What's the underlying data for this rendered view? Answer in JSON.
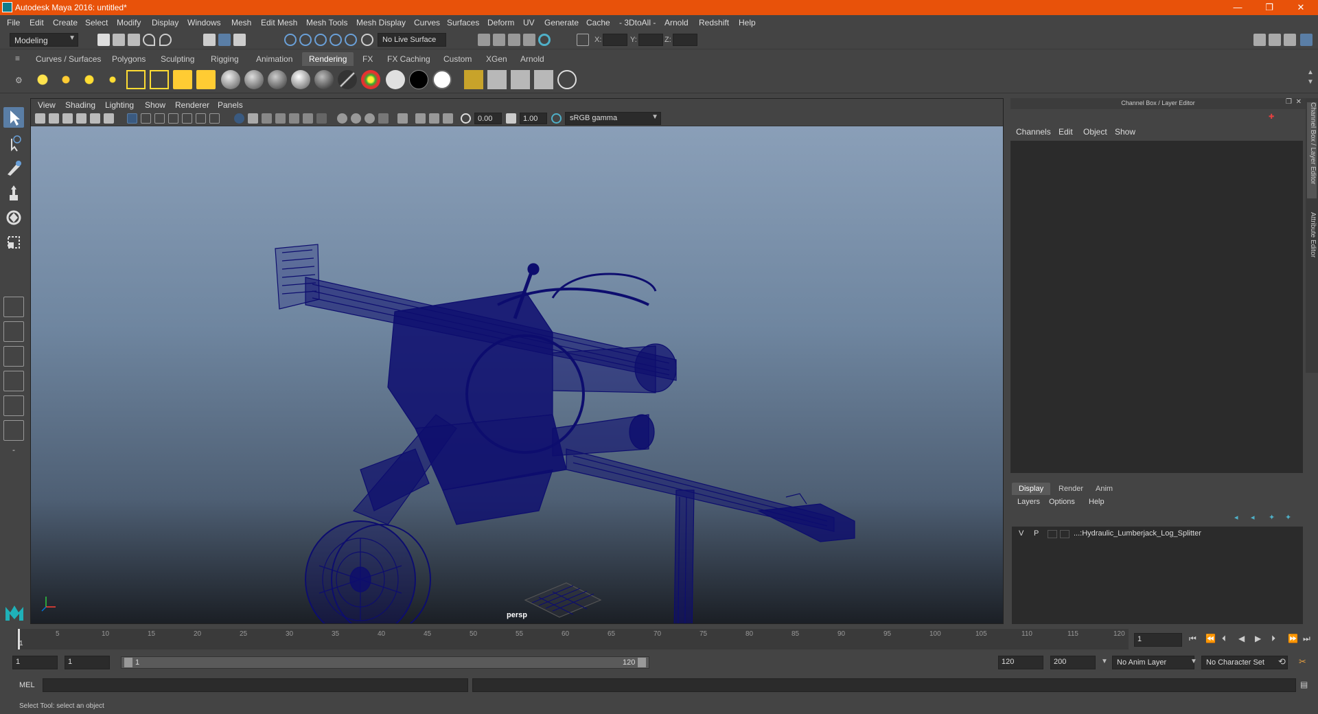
{
  "titlebar": {
    "title": "Autodesk Maya 2016: untitled*",
    "minimize": "—",
    "maximize": "❐",
    "close": "✕"
  },
  "menus": [
    "File",
    "Edit",
    "Create",
    "Select",
    "Modify",
    "Display",
    "Windows",
    "Mesh",
    "Edit Mesh",
    "Mesh Tools",
    "Mesh Display",
    "Curves",
    "Surfaces",
    "Deform",
    "UV",
    "Generate",
    "Cache",
    "- 3DtoAll -",
    "Arnold",
    "Redshift",
    "Help"
  ],
  "statusline": {
    "menu_set": "Modeling",
    "live_surface": "No Live Surface",
    "x_label": "X:",
    "y_label": "Y:",
    "z_label": "Z:"
  },
  "shelf": {
    "tabs": [
      "Curves / Surfaces",
      "Polygons",
      "Sculpting",
      "Rigging",
      "Animation",
      "Rendering",
      "FX",
      "FX Caching",
      "Custom",
      "XGen",
      "Arnold"
    ],
    "active_tab": "Rendering"
  },
  "viewport": {
    "menus": [
      "View",
      "Shading",
      "Lighting",
      "Show",
      "Renderer",
      "Panels"
    ],
    "exposure": "0.00",
    "gamma": "1.00",
    "color_space": "sRGB gamma",
    "camera": "persp",
    "wire_color": "#0d0d6e"
  },
  "rightpanel": {
    "title": "Channel Box / Layer Editor",
    "menus": [
      "Channels",
      "Edit",
      "Object",
      "Show"
    ],
    "layer_tabs": [
      "Display",
      "Render",
      "Anim"
    ],
    "active_layer_tab": "Display",
    "layer_menus": [
      "Layers",
      "Options",
      "Help"
    ],
    "layer": {
      "v": "V",
      "p": "P",
      "name": "...:Hydraulic_Lumberjack_Log_Splitter"
    },
    "vertical_tabs": [
      "Channel Box / Layer Editor",
      "Attribute Editor"
    ]
  },
  "timeline": {
    "ticks": [
      "1",
      "5",
      "10",
      "15",
      "20",
      "25",
      "30",
      "35",
      "40",
      "45",
      "50",
      "55",
      "60",
      "65",
      "70",
      "75",
      "80",
      "85",
      "90",
      "95",
      "100",
      "105",
      "110",
      "115",
      "120"
    ],
    "current_frame": "1"
  },
  "range": {
    "start": "1",
    "start_inner": "1",
    "slider_start": "1",
    "slider_end": "120",
    "end_inner": "120",
    "end": "200",
    "anim_layer": "No Anim Layer",
    "character_set": "No Character Set"
  },
  "cmdline": {
    "lang": "MEL"
  },
  "helpline": {
    "text": "Select Tool: select an object"
  },
  "colors": {
    "title_bar": "#e8520a",
    "active_tool": "#5a7ea6"
  }
}
